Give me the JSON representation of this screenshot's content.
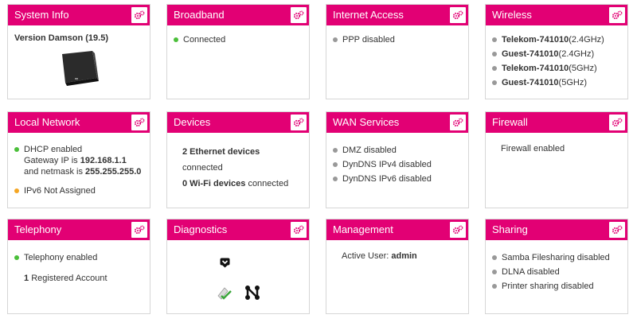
{
  "colors": {
    "accent": "#e20074",
    "ok": "#4bbf3a",
    "warn": "#f5a623",
    "neutral": "#999999"
  },
  "cards": {
    "system_info": {
      "title": "System Info",
      "version": "Version Damson (19.5)"
    },
    "broadband": {
      "title": "Broadband",
      "status": "Connected"
    },
    "internet_access": {
      "title": "Internet Access",
      "status": "PPP disabled"
    },
    "wireless": {
      "title": "Wireless",
      "networks": [
        {
          "ssid": "Telekom-741010",
          "band": "(2.4GHz)"
        },
        {
          "ssid": "Guest-741010",
          "band": "(2.4GHz)"
        },
        {
          "ssid": "Telekom-741010",
          "band": "(5GHz)"
        },
        {
          "ssid": "Guest-741010",
          "band": "(5GHz)"
        }
      ]
    },
    "local_network": {
      "title": "Local Network",
      "dhcp": "DHCP enabled",
      "gateway_prefix": "Gateway IP is",
      "gateway_ip": "192.168.1.1",
      "gateway_mid": "and netmask is",
      "netmask": "255.255.255.0",
      "ipv6": "IPv6 Not Assigned"
    },
    "devices": {
      "title": "Devices",
      "ethernet_count": "2 Ethernet devices",
      "ethernet_suffix": "connected",
      "wifi_count": "0 Wi-Fi devices",
      "wifi_suffix": "connected"
    },
    "wan_services": {
      "title": "WAN Services",
      "items": [
        "DMZ disabled",
        "DynDNS IPv4 disabled",
        "DynDNS IPv6 disabled"
      ]
    },
    "firewall": {
      "title": "Firewall",
      "status": "Firewall enabled"
    },
    "telephony": {
      "title": "Telephony",
      "status": "Telephony enabled",
      "account_count": "1",
      "account_label": "Registered Account"
    },
    "diagnostics": {
      "title": "Diagnostics",
      "icons": [
        "shield-icon",
        "network-check-icon",
        "topology-icon"
      ]
    },
    "management": {
      "title": "Management",
      "user_label": "Active User:",
      "user": "admin"
    },
    "sharing": {
      "title": "Sharing",
      "items": [
        "Samba Filesharing disabled",
        "DLNA disabled",
        "Printer sharing disabled"
      ]
    }
  }
}
